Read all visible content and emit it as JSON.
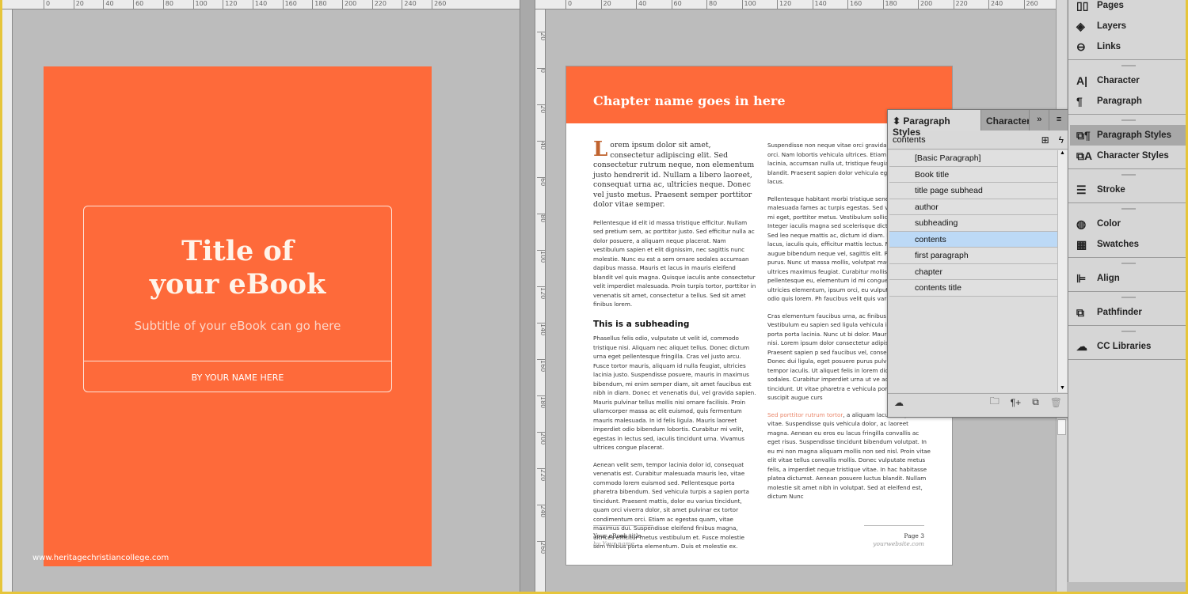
{
  "ruler_left": [
    "0",
    "20",
    "40",
    "60",
    "80",
    "100",
    "120",
    "140",
    "160",
    "180",
    "200",
    "220",
    "240",
    "260"
  ],
  "ruler_right": [
    "0",
    "20",
    "40",
    "60",
    "80",
    "100",
    "120",
    "140",
    "160",
    "180",
    "200",
    "220",
    "240",
    "260"
  ],
  "ruler_vertical": [
    "20",
    "0",
    "20",
    "40",
    "60",
    "80",
    "100",
    "120",
    "140",
    "160",
    "180",
    "200",
    "220",
    "240",
    "260"
  ],
  "cover": {
    "title_line1": "Title of",
    "title_line2": "your eBook",
    "subtitle": "Subtitle of your eBook can go here",
    "byline": "BY YOUR NAME HERE",
    "watermark": "www.heritagechristiancollege.com",
    "color": "#fe6a3a"
  },
  "page": {
    "chapter_title": "Chapter name goes in here",
    "drop_cap": "L",
    "lead": "orem ipsum dolor sit amet, consectetur adipiscing elit. Sed consectetur rutrum neque, non elementum justo hendrerit id. Nullam a libero laoreet, consequat urna ac, ultricies neque. Donec vel justo metus. Praesent semper porttitor dolor vitae semper.",
    "para1": "Pellentesque id elit id massa tristique efficitur. Nullam sed pretium sem, ac porttitor justo. Sed efficitur nulla ac dolor posuere, a aliquam neque placerat. Nam vestibulum sapien et elit dignissim, nec sagittis nunc molestie. Nunc eu est a sem ornare sodales accumsan dapibus massa. Mauris et lacus in mauris eleifend blandit vel quis magna. Quisque iaculis ante consectetur velit imperdiet malesuada. Proin turpis tortor, porttitor in venenatis sit amet, consectetur a tellus. Sed sit amet finibus lorem.",
    "subheading": "This is a subheading",
    "para2": "Phasellus felis odio, vulputate ut velit id, commodo tristique nisi. Aliquam nec aliquet tellus. Donec dictum urna eget pellentesque fringilla. Cras vel justo arcu. Fusce tortor mauris, aliquam id nulla feugiat, ultricies lacinia justo. Suspendisse posuere, mauris in maximus bibendum, mi enim semper diam, sit amet faucibus est nibh in diam. Donec et venenatis dui, vel gravida sapien. Mauris pulvinar tellus mollis nisi ornare facilisis. Proin ullamcorper massa ac elit euismod, quis fermentum mauris malesuada. In id felis ligula. Mauris laoreet imperdiet odio bibendum lobortis. Curabitur mi velit, egestas in lectus sed, iaculis tincidunt urna. Vivamus ultrices congue placerat.",
    "para3": "Aenean velit sem, tempor lacinia dolor id, consequat venenatis est. Curabitur malesuada mauris leo, vitae commodo lorem euismod sed. Pellentesque porta pharetra bibendum. Sed vehicula turpis a sapien porta tincidunt. Praesent mattis, dolor eu varius tincidunt, quam orci viverra dolor, sit amet pulvinar ex tortor condimentum orci. Etiam ac egestas quam, vitae maximus dui. Suspendisse eleifend finibus magna, ultrices efficitur metus vestibulum et. Fusce molestie sem finibus porta elementum. Duis et molestie ex.",
    "col2_para1": "Suspendisse non neque vitae orci gravida laoreet vel orci. Nam lobortis vehicula ultrices. Etiam Sed eu urna lacinia, accumsan nulla ut, tristique feugiat non ex a blandit. Praesent sapien dolor vehicula eget, feugiat sed lacus.",
    "col2_para2": "Pellentesque habitant morbi tristique senectus malesuada fames ac turpis egestas. Sed vitae egestas mi eget, porttitor metus. Vestibulum sollicitudin dictum. Integer iaculis magna sed scelerisque dictum mi rutrum. Sed leo neque mattis ac, dictum id diam. Etiam dui lacus, iaculis quis, efficitur mattis lectus. Nulla vitae augue bibendum neque vel, sagittis elit. Pellentesque purus. Nunc ut massa mollis, volutpat mauris est. Nunc ultrices maximus feugiat. Curabitur mollis eget pellentesque eu, elementum id mi congue, neque vel ultricies elementum, ipsum orci, eu vulputate mauris odio quis lorem. Ph faucibus velit quis varius mattis.",
    "col2_para3": "Cras elementum faucibus urna, ac finibus arcu vel. Vestibulum eu sapien sed ligula vehicula id est. Aenean porta porta lacinia. Nunc ut bi dolor. Mauris ut fringilla nisi. Lorem ipsum dolor consectetur adipiscing elit. Praesent sapien p sed faucibus vel, consectetur sed dui. Donec dui ligula, eget posuere purus pulvinar vel. Ut tempor iaculis. Ut aliquet felis in lorem dictum dolor sodales. Curabitur imperdiet urna ut ve ac pretium sem tincidunt. Ut vitae pharetra e vehicula porta dolor, non suscipit augue curs",
    "col2_link": "Sed porttitor rutrum tortor",
    "col2_para4": ", a aliquam lacus tempor vitae. Suspendisse quis vehicula dolor, ac laoreet magna. Aenean eu eros eu lacus fringilla convallis ac eget risus. Suspendisse tincidunt bibendum volutpat. In eu mi non magna aliquam mollis non sed nisl. Proin vitae elit vitae tellus convallis mollis. Donec vulputate metus felis, a imperdiet neque tristique vitae. In hac habitasse platea dictumst. Aenean posuere luctus blandit. Nullam molestie sit amet nibh in volutpat. Sed at eleifend est, dictum Nunc",
    "footer_title": "Your eBook title",
    "footer_author": "by Your name",
    "page_number": "Page 3",
    "website": "yourwebsite.com"
  },
  "paragraph_styles_panel": {
    "tab_active": "Paragraph Styles",
    "tab_other": "Character Styles",
    "collapse_icon": "»",
    "current_style": "contents",
    "styles": [
      "[Basic Paragraph]",
      "Book title",
      "title page subhead",
      "author",
      "subheading",
      "contents",
      "first paragraph",
      "chapter",
      "contents title"
    ],
    "selected_index": 5,
    "selected_color": "#bcd9f6"
  },
  "dock": {
    "groups": [
      [
        {
          "label": "Pages",
          "icon": "▯▯"
        },
        {
          "label": "Layers",
          "icon": "◈"
        },
        {
          "label": "Links",
          "icon": "⊖"
        }
      ],
      [
        {
          "label": "Character",
          "icon": "A|"
        },
        {
          "label": "Paragraph",
          "icon": "¶"
        }
      ],
      [
        {
          "label": "Paragraph Styles",
          "icon": "⧉¶"
        },
        {
          "label": "Character Styles",
          "icon": "⧉A"
        }
      ],
      [
        {
          "label": "Stroke",
          "icon": "☰"
        }
      ],
      [
        {
          "label": "Color",
          "icon": "◍"
        },
        {
          "label": "Swatches",
          "icon": "▦"
        }
      ],
      [
        {
          "label": "Align",
          "icon": "⊫"
        }
      ],
      [
        {
          "label": "Pathfinder",
          "icon": "⧉"
        }
      ],
      [
        {
          "label": "CC Libraries",
          "icon": "☁"
        }
      ]
    ],
    "selected": "Paragraph Styles"
  }
}
